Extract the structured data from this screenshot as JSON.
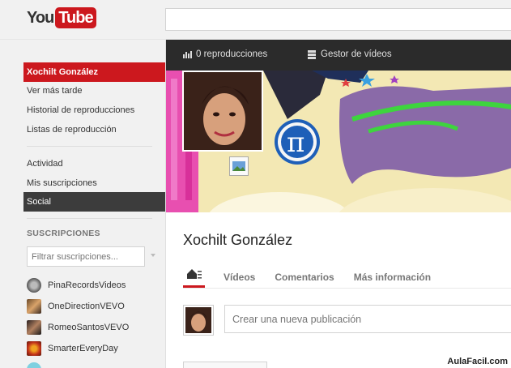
{
  "logo": {
    "you": "You",
    "tube": "Tube"
  },
  "sidebar": {
    "items": [
      {
        "label": "Xochilt González"
      },
      {
        "label": "Ver más tarde"
      },
      {
        "label": "Historial de reproducciones"
      },
      {
        "label": "Listas de reproducción"
      },
      {
        "label": "Actividad"
      },
      {
        "label": "Mis suscripciones"
      },
      {
        "label": "Social"
      }
    ],
    "subscriptions_title": "SUSCRIPCIONES",
    "filter_placeholder": "Filtrar suscripciones...",
    "subscriptions": [
      {
        "label": "PinaRecordsVideos"
      },
      {
        "label": "OneDirectionVEVO"
      },
      {
        "label": "RomeoSantosVEVO"
      },
      {
        "label": "SmarterEveryDay"
      }
    ]
  },
  "stats": {
    "views": "0 reproducciones",
    "manager": "Gestor de vídeos"
  },
  "channel": {
    "name": "Xochilt González",
    "tabs": [
      "Vídeos",
      "Comentarios",
      "Más información"
    ],
    "post_placeholder": "Crear una nueva publicación"
  },
  "watermark": "AulaFacil.com",
  "colors": {
    "brand_red": "#cc181e",
    "dark_bar": "#2b2b2b",
    "active_dark": "#3c3c3c"
  }
}
